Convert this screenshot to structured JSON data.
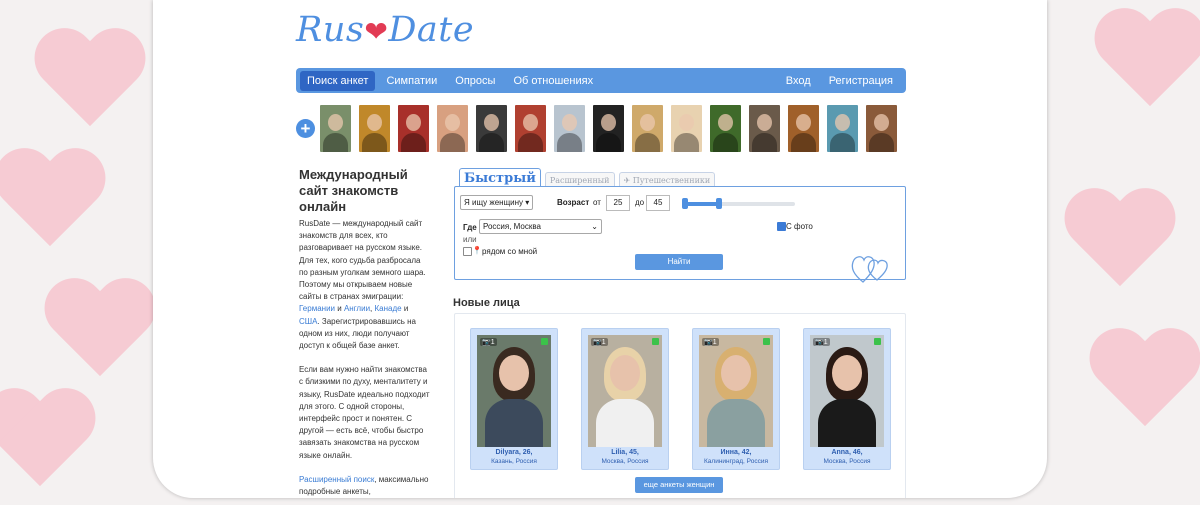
{
  "logo": {
    "part1": "Rus",
    "heart": "❤",
    "part2": "Date"
  },
  "nav": {
    "items": [
      "Поиск анкет",
      "Симпатии",
      "Опросы",
      "Об отношениях"
    ],
    "login": "Вход",
    "register": "Регистрация"
  },
  "avatars": {
    "add_icon": "+",
    "colors": [
      "#7a8f6a",
      "#c0882a",
      "#a8302a",
      "#d8a080",
      "#3a3a3a",
      "#b04030",
      "#b8c4cf",
      "#222222",
      "#cfa96a",
      "#e8d2b0",
      "#3f6a2a",
      "#6a5a4a",
      "#a0602a",
      "#5a9ab0",
      "#8a5a3a"
    ]
  },
  "intro": {
    "title": "Международный сайт знакомств онлайн",
    "p1_text": "RusDate — международный сайт знакомств для всех, кто разговаривает на русском языке. Для тех, кого судьба разбросала по разным уголкам земного шара. Поэтому мы открываем новые сайты в странах эмиграции:",
    "link_germany": "Германии",
    "and1": "и",
    "link_england": "Англии",
    "comma": ",",
    "link_canada": "Канаде",
    "and2": "и",
    "link_usa": "США",
    "p1_end": ". Зарегистрировавшись на одном из них, люди получают доступ к общей базе анкет.",
    "p2": "Если вам нужно найти знакомства с близкими по духу, менталитету и языку, RusDate идеально подходит для этого. С одной стороны, интерфейс прост и понятен. С другой — есть всё, чтобы быстро завязать знакомства на русском языке онлайн.",
    "link_ext": "Расширенный поиск",
    "p3_end": ", максимально подробные анкеты,"
  },
  "search": {
    "tab_quick": "Быстрый",
    "tab_ext": "Расширенный",
    "tab_travel": "✈ Путешественники",
    "seeking": "Я ищу женщину ▾",
    "age_label": "Возраст",
    "from": "от",
    "age_from": "25",
    "to": "до",
    "age_to": "45",
    "where_label": "Где",
    "location": "Россия, Москва",
    "photo_label": "С фото",
    "or": "или",
    "nearby": "рядом со мной",
    "pin_icon": "📍",
    "button": "Найти"
  },
  "faces": {
    "title": "Новые лица",
    "camera": "📷1",
    "profiles": [
      {
        "name": "Dilyara, 26,",
        "city": "Казань, Россия",
        "hair": "#3a2a20",
        "body": "#3c4a5c",
        "bg": "#6a7a6a"
      },
      {
        "name": "Lilia, 45,",
        "city": "Москва, Россия",
        "hair": "#e8d2a8",
        "body": "#f0f0f0",
        "bg": "#b8b0a0"
      },
      {
        "name": "Инна, 42,",
        "city": "Калининград, Россия",
        "hair": "#d8b070",
        "body": "#8aa0a0",
        "bg": "#c8b8a0"
      },
      {
        "name": "Anna, 46,",
        "city": "Москва, Россия",
        "hair": "#2a1a14",
        "body": "#1a1a1a",
        "bg": "#c0c8cc"
      }
    ],
    "more_button": "еще анкеты женщин"
  }
}
